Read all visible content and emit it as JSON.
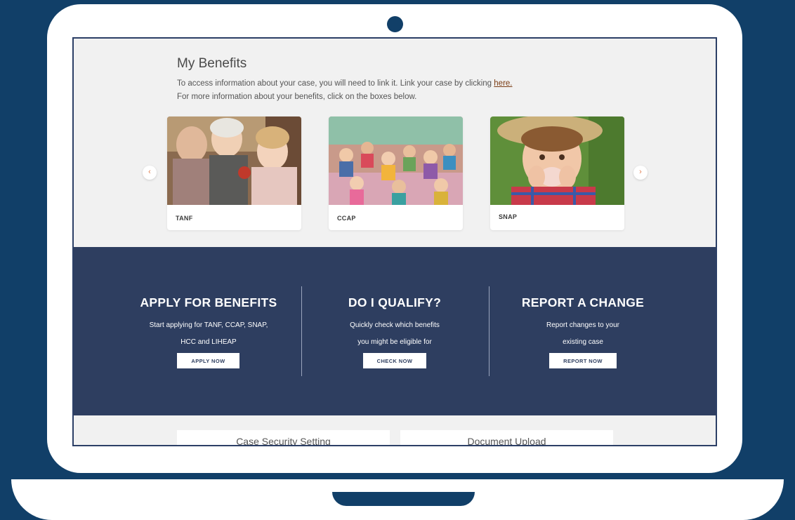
{
  "colors": {
    "background": "#113f68",
    "screen_band": "#2e3e60",
    "link": "#7a3b12",
    "arrow": "#e07c4d"
  },
  "benefits": {
    "title": "My Benefits",
    "line1": "To access information about your case, you will need to link it. Link your case by clicking ",
    "link_text": "here.",
    "line2": "For more information about your benefits, click on the boxes below.",
    "prev_arrow": "‹",
    "next_arrow": "›",
    "cards": [
      {
        "label": "TANF",
        "image": "family-photo"
      },
      {
        "label": "CCAP",
        "image": "classroom-photo"
      },
      {
        "label": "SNAP",
        "image": "child-eating-photo"
      }
    ]
  },
  "actions": [
    {
      "title": "APPLY FOR BENEFITS",
      "line1": "Start applying for TANF, CCAP, SNAP,",
      "line2": "HCC and LIHEAP",
      "button": "APPLY NOW"
    },
    {
      "title": "DO I QUALIFY?",
      "line1": "Quickly check which benefits",
      "line2": "you might be eligible for",
      "button": "CHECK NOW"
    },
    {
      "title": "REPORT A CHANGE",
      "line1": "Report changes to your",
      "line2": "existing case",
      "button": "REPORT NOW"
    }
  ],
  "tiles": [
    {
      "label": "Case Security Setting"
    },
    {
      "label": "Document Upload"
    }
  ]
}
